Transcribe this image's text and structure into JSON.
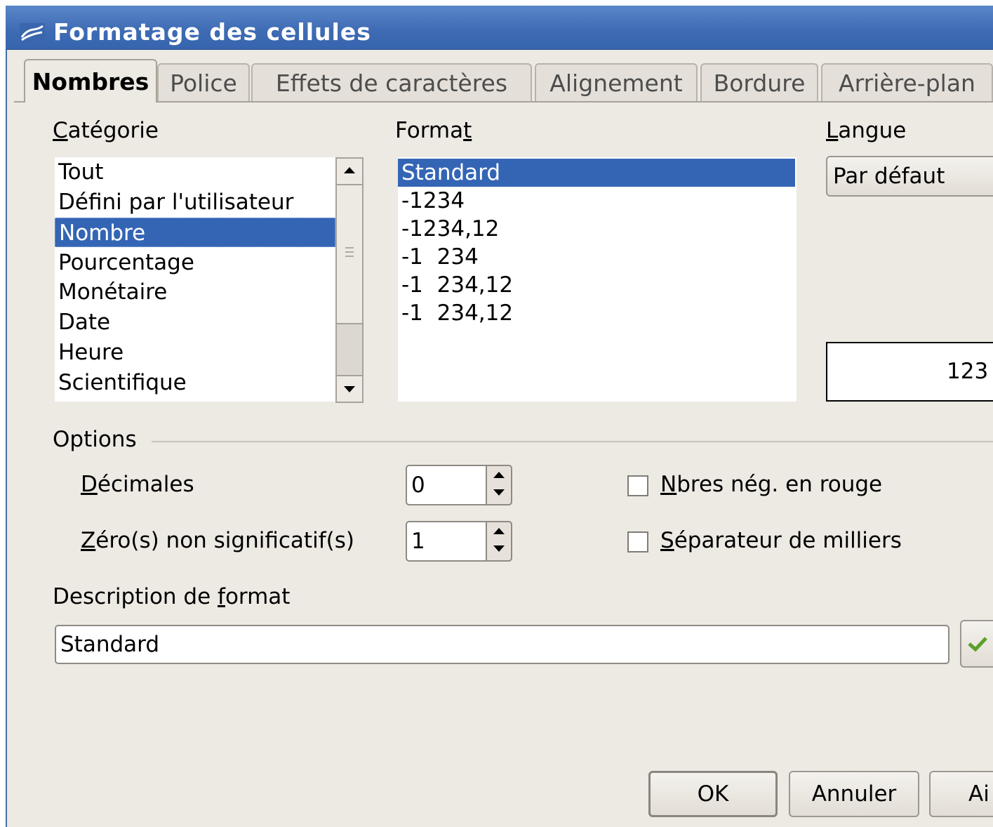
{
  "window": {
    "title": "Formatage des cellules"
  },
  "tabs": [
    {
      "label": "Nombres",
      "active": true
    },
    {
      "label": "Police"
    },
    {
      "label": "Effets de caractères"
    },
    {
      "label": "Alignement"
    },
    {
      "label": "Bordure"
    },
    {
      "label": "Arrière-plan"
    }
  ],
  "category": {
    "label_mnemonic": "C",
    "label_rest": "atégorie",
    "items": [
      "Tout",
      "Défini par l'utilisateur",
      "Nombre",
      "Pourcentage",
      "Monétaire",
      "Date",
      "Heure",
      "Scientifique"
    ],
    "selected": "Nombre"
  },
  "format": {
    "label_before": "Forma",
    "label_mnemonic": "t",
    "items": [
      "Standard",
      "-1234",
      "-1234,12",
      "-1  234",
      "-1  234,12",
      "-1  234,12"
    ],
    "selected": "Standard"
  },
  "language": {
    "label_mnemonic": "L",
    "label_rest": "angue",
    "value": "Par défaut"
  },
  "preview": {
    "value": "123"
  },
  "options": {
    "legend": "Options",
    "decimals": {
      "label_mnemonic": "D",
      "label_rest": "écimales",
      "value": "0"
    },
    "leading_zeros": {
      "label_mnemonic": "Z",
      "label_rest": "éro(s) non significatif(s)",
      "value": "1"
    },
    "negative_red": {
      "label_mnemonic": "N",
      "label_rest": "bres nég. en rouge",
      "checked": false
    },
    "thousands_sep": {
      "label_mnemonic": "S",
      "label_rest": "éparateur de milliers",
      "checked": false
    }
  },
  "format_description": {
    "label_before": "Description de ",
    "label_mnemonic": "f",
    "label_after": "ormat",
    "value": "Standard"
  },
  "buttons": {
    "ok": "OK",
    "cancel": "Annuler",
    "help": "Ai"
  },
  "colors": {
    "title_bar": "#3f6cb4",
    "selection": "#3465b5",
    "dialog_bg": "#ede9e3"
  }
}
